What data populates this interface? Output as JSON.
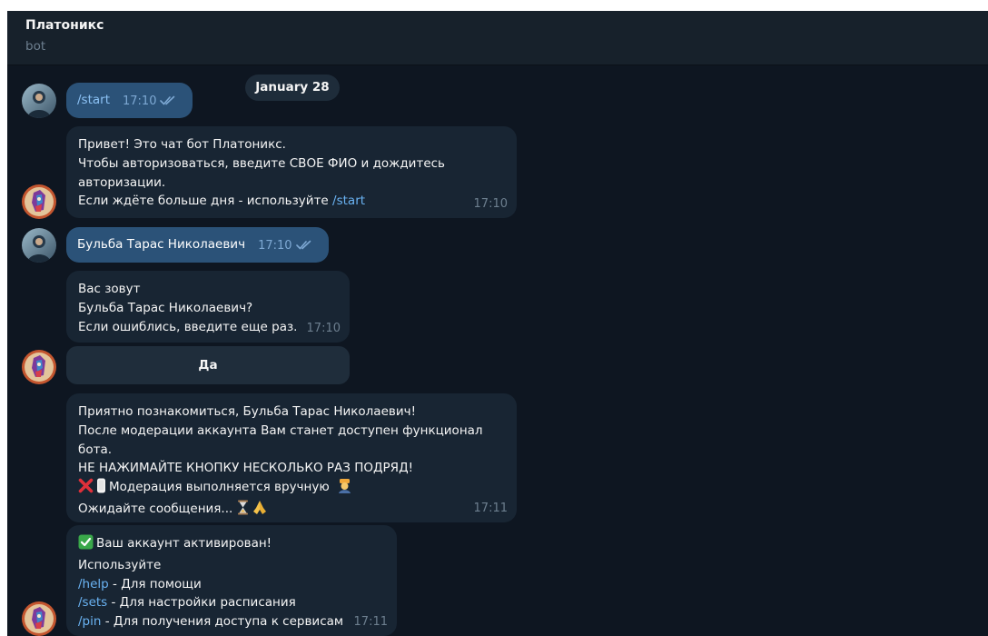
{
  "header": {
    "title": "Платоникс",
    "subtitle": "bot"
  },
  "date_separator": "January 28",
  "messages": [
    {
      "type": "outgoing",
      "text": "/start",
      "time": "17:10",
      "status": "read"
    },
    {
      "type": "incoming",
      "lines": [
        "Привет! Это чат бот Платоникс.",
        "Чтобы авторизоваться, введите СВОЕ ФИО и дождитесь",
        "авторизации."
      ],
      "line4_prefix": "Если ждёте больше дня - используйте ",
      "line4_command": "/start",
      "time": "17:10"
    },
    {
      "type": "outgoing",
      "text": "Бульба Тарас Николаевич",
      "time": "17:10",
      "status": "read"
    },
    {
      "type": "incoming",
      "lines": [
        "Вас зовут",
        "Бульба Тарас Николаевич?",
        "Если ошиблись, введите еще раз."
      ],
      "time": "17:10",
      "inline_button": "Да"
    },
    {
      "type": "incoming",
      "lines": [
        "Приятно познакомиться, Бульба Тарас Николаевич!",
        "После модерации аккаунта Вам станет доступен функционал",
        "бота.",
        "НЕ НАЖИМАЙТЕ КНОПКУ НЕСКОЛЬКО РАЗ ПОДРЯД!"
      ],
      "line5_text": "Модерация выполняется вручную",
      "line6_text": "Ожидайте сообщения...",
      "time": "17:11"
    },
    {
      "type": "incoming",
      "line1_text": "Ваш аккаунт активирован!",
      "line2_text": "Используйте",
      "commands": [
        {
          "command": "/help",
          "description": " - Для помощи"
        },
        {
          "command": "/sets",
          "description": " - Для настройки расписания"
        },
        {
          "command": "/pin",
          "description": " - Для получения доступа к сервисам"
        }
      ],
      "time": "17:11"
    }
  ],
  "icons": {
    "read_status": "double-check-icon",
    "cross": "cross-mark-icon",
    "phone": "mobile-phone-icon",
    "operator": "guard-icon",
    "hourglass": "hourglass-icon",
    "pray": "folded-hands-icon",
    "check": "check-mark-icon"
  },
  "colors": {
    "chat_background": "#0e1621",
    "header_background": "#17212b",
    "incoming_bubble": "#182533",
    "outgoing_bubble": "#2b5278",
    "link": "#6ab3f3",
    "muted_text": "#6d7f8f"
  }
}
